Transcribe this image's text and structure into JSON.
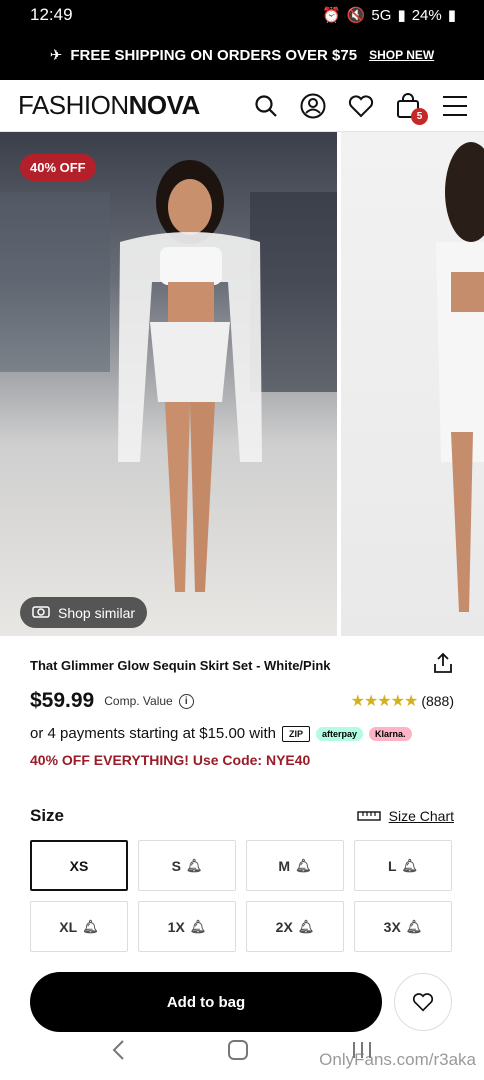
{
  "status": {
    "time": "12:49",
    "network": "5G",
    "battery": "24%"
  },
  "promo_bar": {
    "text": "FREE SHIPPING ON ORDERS OVER $75",
    "link": "SHOP NEW"
  },
  "header": {
    "logo_thin": "FASHION",
    "logo_bold": "NOVA",
    "bag_count": "5"
  },
  "gallery": {
    "discount_badge": "40% OFF",
    "shop_similar": "Shop similar"
  },
  "product": {
    "title": "That Glimmer Glow Sequin Skirt Set - White/Pink",
    "price": "$59.99",
    "comp_value": "Comp. Value",
    "stars": "★★★★★",
    "review_count": "(888)",
    "payments_text": "or 4 payments starting at $15.00 with",
    "pay_zip": "ZIP",
    "pay_afterpay": "afterpay",
    "pay_klarna": "Klarna.",
    "promo_code": "40% OFF EVERYTHING! Use Code: NYE40"
  },
  "sizes": {
    "label": "Size",
    "chart_label": "Size Chart",
    "options": [
      "XS",
      "S",
      "M",
      "L",
      "XL",
      "1X",
      "2X",
      "3X"
    ],
    "selected": "XS"
  },
  "cta": {
    "add_to_bag": "Add to bag"
  },
  "watermark": "OnlyFans.com/r3aka",
  "colors": {
    "badge_red": "#b3202a",
    "promo_red": "#9b1c26",
    "star_gold": "#d4b21f",
    "bag_badge": "#c62828"
  }
}
